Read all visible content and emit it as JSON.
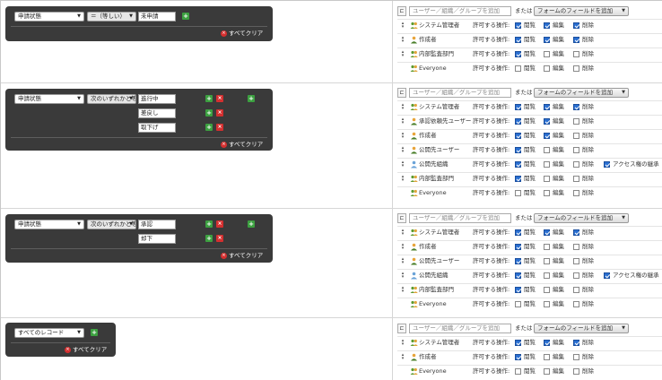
{
  "common": {
    "add_placeholder": "ユーザー／組織／グループを追加",
    "or_label": "または",
    "field_button": "フォームのフィールドを追加",
    "allow_label": "許可する操作:",
    "perm_view": "閲覧",
    "perm_edit": "編集",
    "perm_delete": "削除",
    "perm_inherit": "アクセス権の継承",
    "clear_all": "すべてクリア"
  },
  "sections": [
    {
      "condition": {
        "field": "申請状態",
        "operator": "＝（等しい）",
        "values": [
          "未申請"
        ]
      },
      "entities": [
        {
          "name": "システム管理者",
          "icon": "group-icon",
          "view": true,
          "edit": true,
          "delete": true
        },
        {
          "name": "作成者",
          "icon": "user-icon",
          "view": true,
          "edit": true,
          "delete": true
        },
        {
          "name": "内部監査部門",
          "icon": "group-icon",
          "view": true,
          "edit": false,
          "delete": false
        },
        {
          "name": "Everyone",
          "icon": "group-icon",
          "view": false,
          "edit": false,
          "delete": false
        }
      ]
    },
    {
      "condition": {
        "field": "申請状態",
        "operator": "次のいずれかと等しい",
        "values": [
          "進行中",
          "差戻し",
          "取下げ"
        ]
      },
      "entities": [
        {
          "name": "システム管理者",
          "icon": "group-icon",
          "view": true,
          "edit": true,
          "delete": true
        },
        {
          "name": "承認依頼先ユーザー",
          "icon": "user-icon",
          "view": true,
          "edit": true,
          "delete": false
        },
        {
          "name": "作成者",
          "icon": "user-icon",
          "view": true,
          "edit": true,
          "delete": false
        },
        {
          "name": "公開先ユーザー",
          "icon": "user-icon",
          "view": true,
          "edit": false,
          "delete": false
        },
        {
          "name": "公開先組織",
          "icon": "org-icon",
          "view": true,
          "edit": false,
          "delete": false,
          "inherit": true
        },
        {
          "name": "内部監査部門",
          "icon": "group-icon",
          "view": true,
          "edit": false,
          "delete": false
        },
        {
          "name": "Everyone",
          "icon": "group-icon",
          "view": false,
          "edit": false,
          "delete": false
        }
      ]
    },
    {
      "condition": {
        "field": "申請状態",
        "operator": "次のいずれかと等しい",
        "values": [
          "承認",
          "却下"
        ]
      },
      "entities": [
        {
          "name": "システム管理者",
          "icon": "group-icon",
          "view": true,
          "edit": true,
          "delete": true
        },
        {
          "name": "作成者",
          "icon": "user-icon",
          "view": true,
          "edit": false,
          "delete": false
        },
        {
          "name": "公開先ユーザー",
          "icon": "user-icon",
          "view": true,
          "edit": false,
          "delete": false
        },
        {
          "name": "公開先組織",
          "icon": "org-icon",
          "view": true,
          "edit": false,
          "delete": false,
          "inherit": true
        },
        {
          "name": "内部監査部門",
          "icon": "group-icon",
          "view": true,
          "edit": false,
          "delete": false
        },
        {
          "name": "Everyone",
          "icon": "group-icon",
          "view": false,
          "edit": false,
          "delete": false
        }
      ]
    },
    {
      "condition": {
        "field": "すべてのレコード"
      },
      "entities": [
        {
          "name": "システム管理者",
          "icon": "group-icon",
          "view": true,
          "edit": true,
          "delete": true
        },
        {
          "name": "作成者",
          "icon": "user-icon",
          "view": true,
          "edit": false,
          "delete": false
        },
        {
          "name": "Everyone",
          "icon": "group-icon",
          "view": false,
          "edit": false,
          "delete": false
        }
      ]
    }
  ]
}
